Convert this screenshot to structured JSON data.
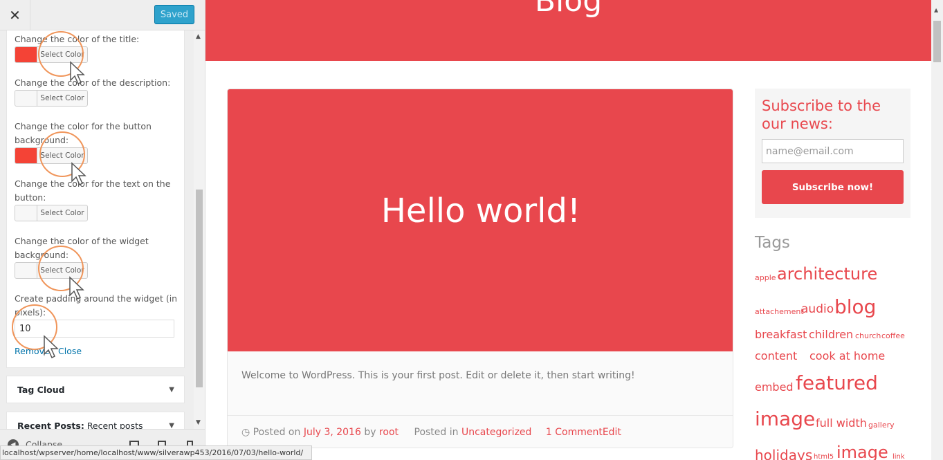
{
  "sidebar": {
    "close_icon": "close-icon",
    "saved_label": "Saved",
    "fields": [
      {
        "label": "Change the color of the title:",
        "swatch": "#f44336"
      },
      {
        "label": "Change the color of the description:",
        "swatch": "#f7f7f7"
      },
      {
        "label": "Change the color for the button background:",
        "swatch": "#f44336"
      },
      {
        "label": "Change the color for the text on the button:",
        "swatch": "#f7f7f7"
      },
      {
        "label": "Change the color of the widget background:",
        "swatch": "#f7f7f7"
      }
    ],
    "select_color_label": "Select Color",
    "padding_label": "Create padding around the widget (in pixels):",
    "padding_value": "10",
    "remove_label": "Remove",
    "separator": "|",
    "close_label": "Close",
    "widgets": [
      {
        "title": "Tag Cloud",
        "subtitle": ""
      },
      {
        "title": "Recent Posts:",
        "subtitle": "Recent posts"
      }
    ],
    "collapse_label": "Collapse"
  },
  "statusbar": {
    "url": "localhost/wpserver/home/localhost/www/silverawp453/2016/07/03/hello-world/"
  },
  "preview": {
    "site_title": "Blog",
    "post": {
      "title": "Hello world!",
      "excerpt": "Welcome to WordPress. This is your first post. Edit or delete it, then start writing!",
      "posted_on_label": "Posted on",
      "date": "July 3, 2016",
      "by_label": "by",
      "author": "root",
      "posted_in_label": "Posted in",
      "category": "Uncategorized",
      "comments": "1 Comment",
      "edit": "Edit"
    },
    "subscribe": {
      "title": "Subscribe to the our news:",
      "email_placeholder": "name@email.com",
      "button": "Subscribe now!"
    },
    "tags_title": "Tags",
    "tags": [
      "apple",
      "architecture",
      "attachement",
      "audio",
      "blog",
      "breakfast",
      "children",
      "church",
      "coffee",
      "content",
      "cook at home",
      "embed",
      "featured",
      "image",
      "full width",
      "gallery",
      "holidays",
      "html5",
      "image",
      "link"
    ]
  },
  "colors": {
    "accent": "#e8474d",
    "wp_blue": "#2ea2cc",
    "annotation": "#f0955a"
  }
}
